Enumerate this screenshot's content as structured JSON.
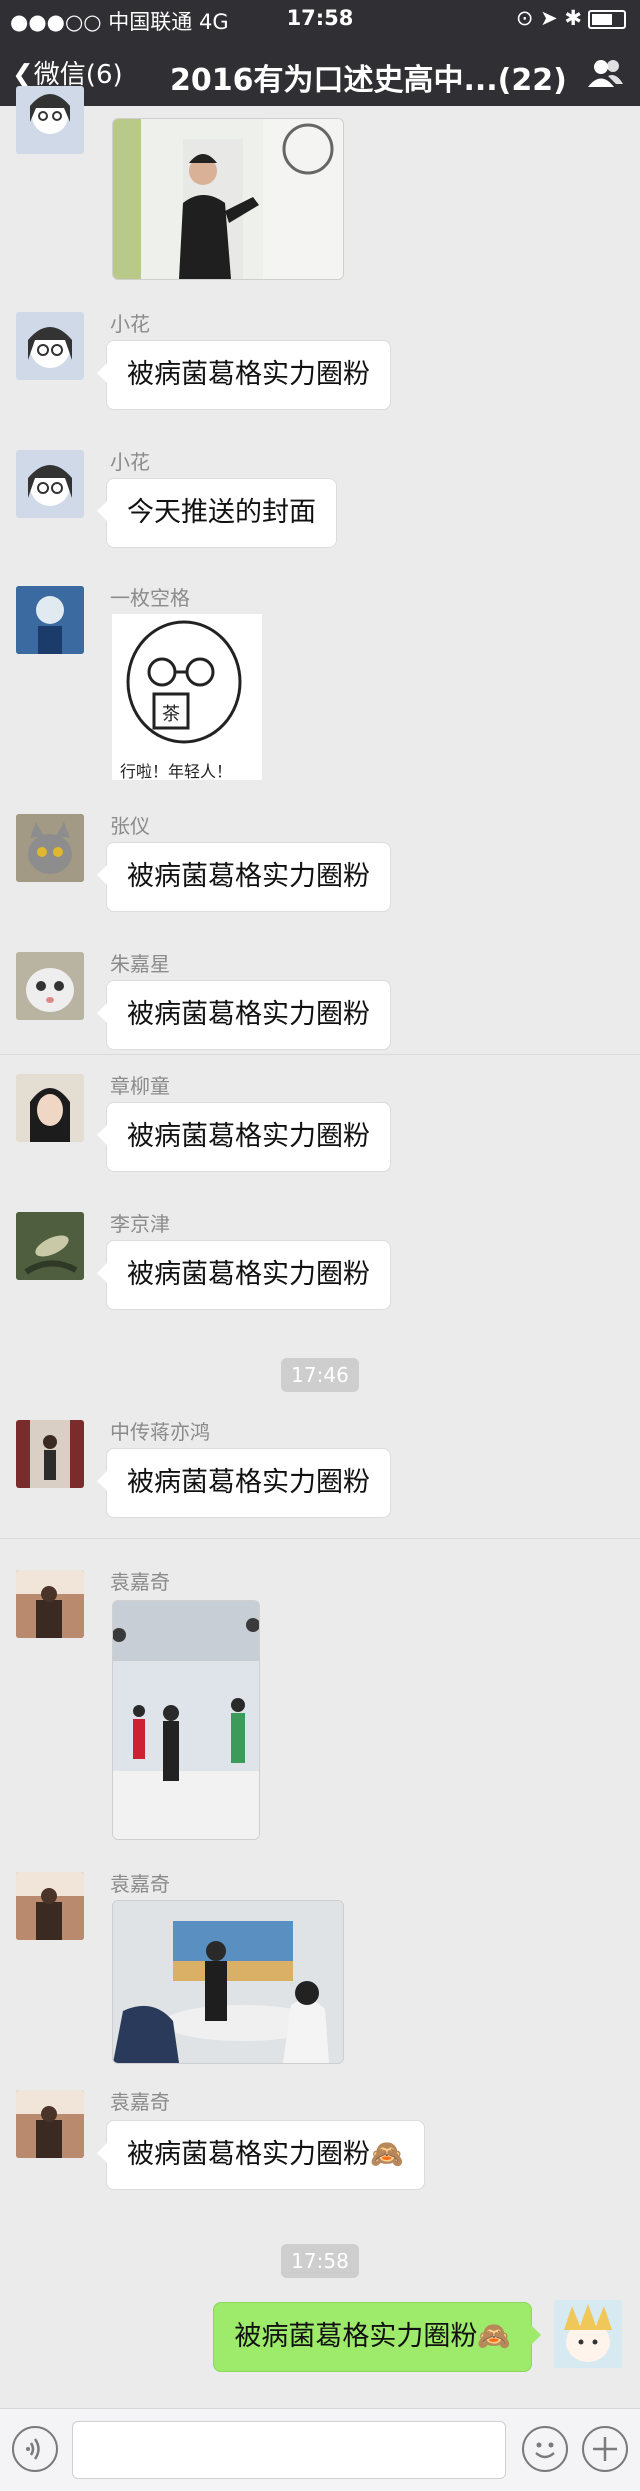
{
  "status_bar": {
    "carrier": "●●●○○ 中国联通  4G",
    "time": "17:58"
  },
  "nav": {
    "back_label": "微信(6)",
    "title": "2016有为口述史高中...(22)"
  },
  "messages": {
    "m1_name": "小花",
    "m1_text": "被病菌葛格实力圈粉",
    "m2_name": "小花",
    "m2_text": "今天推送的封面",
    "m3_name": "一枚空格",
    "m3_sticker_text": "行啦！年轻人！",
    "m3_cup_text": "茶",
    "m4_name": "张仪",
    "m4_text": "被病菌葛格实力圈粉",
    "m5_name": "朱嘉星",
    "m5_text": "被病菌葛格实力圈粉",
    "m6_name": "章柳童",
    "m6_text": "被病菌葛格实力圈粉",
    "m7_name": "李京津",
    "m7_text": "被病菌葛格实力圈粉",
    "time1": "17:46",
    "m8_name": "中传蒋亦鸿",
    "m8_text": "被病菌葛格实力圈粉",
    "m9_name": "袁嘉奇",
    "m10_name": "袁嘉奇",
    "m11_name": "袁嘉奇",
    "m11_text": "被病菌葛格实力圈粉🙈",
    "time2": "17:58",
    "m12_text": "被病菌葛格实力圈粉🙈"
  },
  "colors": {
    "nav_bg": "#2f2f34",
    "my_bubble": "#9eea6a",
    "chat_bg": "#ebebeb"
  }
}
